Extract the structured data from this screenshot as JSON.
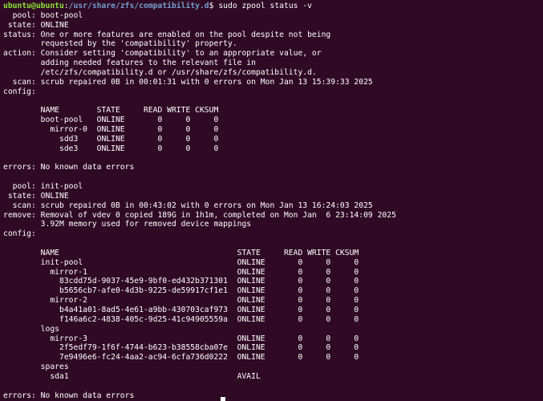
{
  "prompt": {
    "user_host": "ubuntu@ubuntu",
    "separator": ":",
    "path": "/usr/share/zfs/compatibility.d",
    "symbol": "$",
    "command": " sudo zpool status -v"
  },
  "output_lines": [
    "  pool: boot-pool",
    " state: ONLINE",
    "status: One or more features are enabled on the pool despite not being",
    "        requested by the 'compatibility' property.",
    "action: Consider setting 'compatibility' to an appropriate value, or",
    "        adding needed features to the relevant file in",
    "        /etc/zfs/compatibility.d or /usr/share/zfs/compatibility.d.",
    "  scan: scrub repaired 0B in 00:01:31 with 0 errors on Mon Jan 13 15:39:33 2025",
    "config:",
    "",
    "        NAME        STATE     READ WRITE CKSUM",
    "        boot-pool   ONLINE       0     0     0",
    "          mirror-0  ONLINE       0     0     0",
    "            sdd3    ONLINE       0     0     0",
    "            sde3    ONLINE       0     0     0",
    "",
    "errors: No known data errors",
    "",
    "  pool: init-pool",
    " state: ONLINE",
    "  scan: scrub repaired 0B in 00:43:02 with 0 errors on Mon Jan 13 16:24:03 2025",
    "remove: Removal of vdev 0 copied 189G in 1h1m, completed on Mon Jan  6 23:14:09 2025",
    "        3.92M memory used for removed device mappings",
    "config:",
    "",
    "        NAME                                      STATE     READ WRITE CKSUM",
    "        init-pool                                 ONLINE       0     0     0",
    "          mirror-1                                ONLINE       0     0     0",
    "            83cdd75d-9037-45e9-9bf0-ed432b371301  ONLINE       0     0     0",
    "            b5656cb7-afe0-4d3b-9225-de59917cf1e1  ONLINE       0     0     0",
    "          mirror-2                                ONLINE       0     0     0",
    "            b4a41a01-8ad5-4e61-a9bb-430703caf973  ONLINE       0     0     0",
    "            f146a6c2-4838-405c-9d25-41c94905559a  ONLINE       0     0     0",
    "        logs",
    "          mirror-3                                ONLINE       0     0     0",
    "            2f5edf79-1f6f-4744-b623-b38558cba07e  ONLINE       0     0     0",
    "            7e9496e6-fc24-4aa2-ac94-6cfa736d0222  ONLINE       0     0     0",
    "        spares",
    "          sda1                                    AVAIL",
    "",
    "errors: No known data errors"
  ],
  "colors": {
    "background": "#300a24",
    "text": "#ffffff",
    "user_host": "#8ae234",
    "path": "#729fcf"
  }
}
